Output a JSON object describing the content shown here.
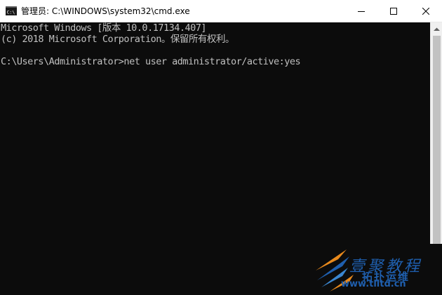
{
  "window": {
    "title": "管理员: C:\\WINDOWS\\system32\\cmd.exe",
    "icon": "cmd-icon",
    "controls": {
      "minimize": "minimize-icon",
      "maximize": "maximize-icon",
      "close": "close-icon"
    }
  },
  "console": {
    "lines": [
      "Microsoft Windows [版本 10.0.17134.407]",
      "(c) 2018 Microsoft Corporation。保留所有权利。",
      "C:\\Users\\Administrator>net user administrator/active:yes"
    ],
    "background": "#0c0c0c",
    "foreground": "#c0c0c0"
  },
  "watermark": {
    "title": "壹聚教程",
    "subtitle": "拓扑运维",
    "url": "www.tlltd.cn",
    "color": "#1f5fae"
  }
}
